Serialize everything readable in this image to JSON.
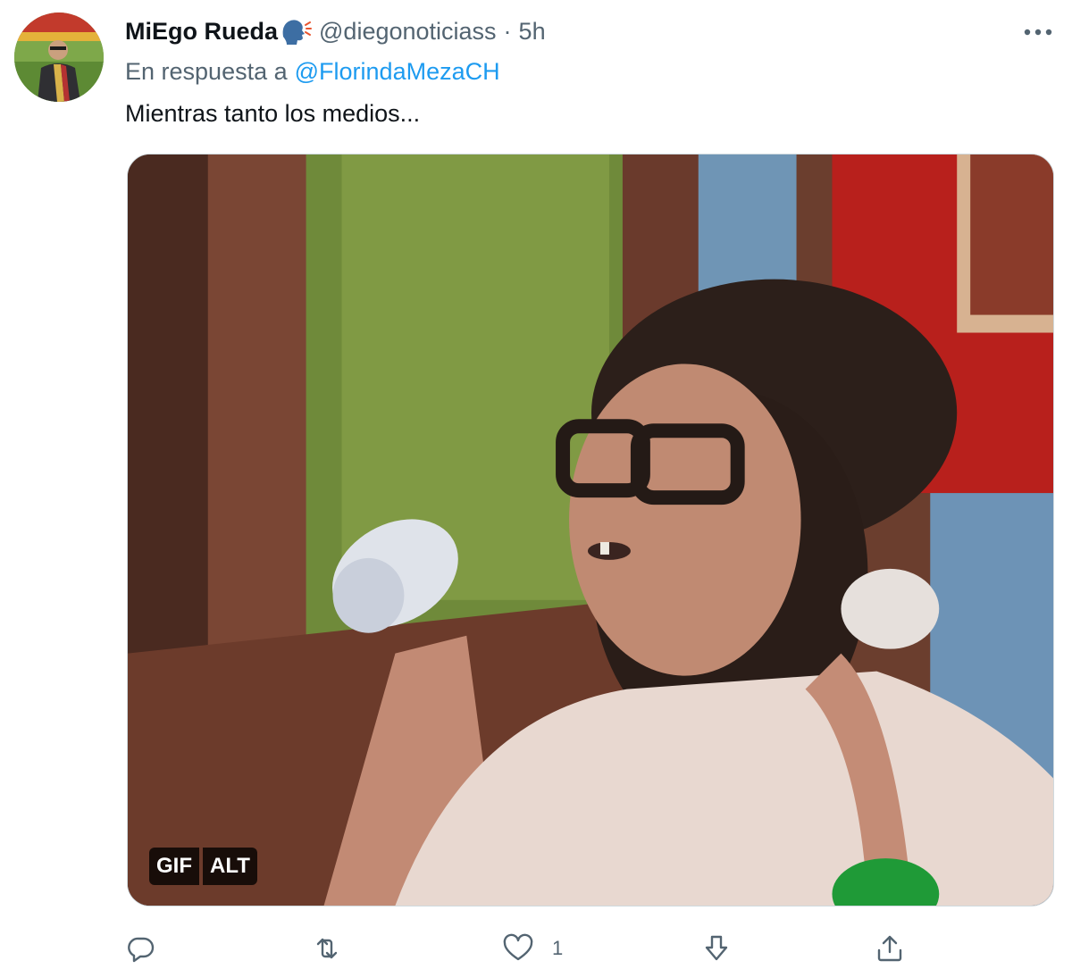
{
  "tweet": {
    "display_name": "MiEgo Rueda",
    "handle": "@diegonoticiass",
    "separator": "·",
    "time": "5h",
    "reply_prefix": "En respuesta a",
    "reply_to": "@FlorindaMezaCH",
    "text": "Mientras tanto los medios...",
    "media": {
      "gif_badge": "GIF",
      "alt_badge": "ALT"
    }
  },
  "actions": {
    "reply_count": "",
    "retweet_count": "",
    "like_count": "1"
  },
  "colors": {
    "link": "#1d9bf0",
    "secondary_text": "#536471",
    "primary_text": "#0f1419"
  },
  "icons": {
    "more": "more-horizontal-icon",
    "speak": "speaking-head-icon",
    "reply": "reply-icon",
    "retweet": "retweet-icon",
    "like": "heart-icon",
    "download": "download-icon",
    "share": "share-icon"
  }
}
